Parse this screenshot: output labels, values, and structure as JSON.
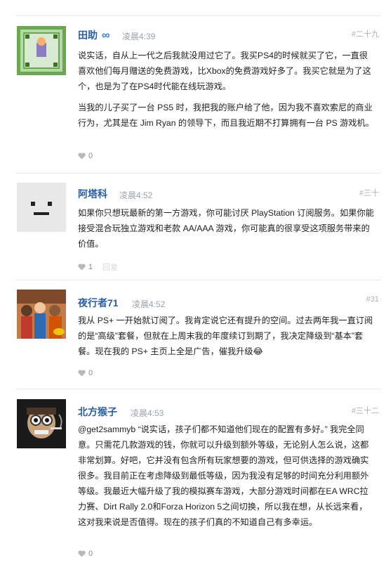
{
  "posts": [
    {
      "author": "田助",
      "badge": "∞",
      "time": "凌晨4:39",
      "number": "#二十九",
      "paragraphs": [
        "说实话，自从上一代之后我就没用过它了。我买PS4的时候就买了它，一直很喜欢他们每月赠送的免费游戏，比Xbox的免费游戏好多了。我买它就是为了这个，也是为了在PS4时代能在线玩游戏。",
        "当我的儿子买了一台 PS5 时，我把我的账户给了他，因为我不喜欢索尼的商业行为，尤其是在 Jim Ryan 的领导下，而且我近期不打算拥有一台 PS 游戏机。"
      ],
      "likes": "0"
    },
    {
      "author": "阿塔科",
      "time": "凌晨4:52",
      "number": "#三十",
      "paragraphs": [
        "如果你只想玩最新的第一方游戏，你可能讨厌 PlayStation 订阅服务。如果你能接受混合玩独立游戏和老款 AA/AAA 游戏，你可能真的很享受这项服务带来的价值。"
      ],
      "likes": "1",
      "extra": "回复"
    },
    {
      "author": "夜行者71",
      "time": "凌晨4:52",
      "number": "#31",
      "paragraphs": [
        "我从 PS+ 一开始就订阅了。我肯定说它还有提升的空间。过去两年我一直订阅的是“高级”套餐，但就在上周末我的年度续订到期了，我决定降级到“基本”套餐。现在我的 PS+ 主页上全是广告，催我升级😂"
      ],
      "likes": "0"
    },
    {
      "author": "北方猴子",
      "time": "凌晨4:53",
      "number": "#三十二",
      "paragraphs": [
        "@get2sammyb “说实话，孩子们都不知道他们现在的配置有多好。” 我完全同意。只需花几款游戏的钱，你就可以升级到额外等级，无论别人怎么说，这都非常划算。好吧，它并没有包含所有玩家想要的游戏，但可供选择的游戏确实很多。我目前正在考虑降级到最低等级，因为我没有足够的时间充分利用额外等级。我最近大幅升级了我的模拟赛车游戏，大部分游戏时间都在EA WRC拉力赛、Dirt Rally 2.0和Forza Horizon 5之间切换，所以我在想，从长远来看，这对我来说是否值得。现在的孩子们真的不知道自己有多幸运。"
      ],
      "likes": "0"
    }
  ]
}
